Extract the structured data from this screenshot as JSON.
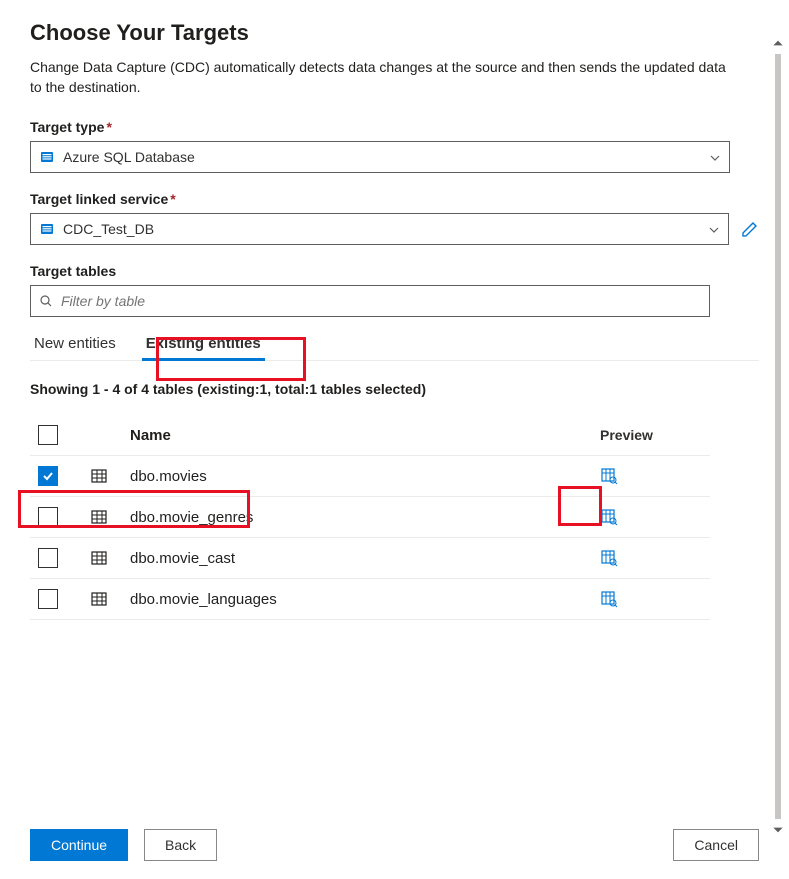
{
  "header": {
    "title": "Choose Your Targets",
    "description": "Change Data Capture (CDC) automatically detects data changes at the source and then sends the updated data to the destination."
  },
  "fields": {
    "target_type": {
      "label": "Target type",
      "value": "Azure SQL Database"
    },
    "target_linked_service": {
      "label": "Target linked service",
      "value": "CDC_Test_DB"
    },
    "target_tables": {
      "label": "Target tables",
      "placeholder": "Filter by table"
    }
  },
  "tabs": {
    "new_entities": "New entities",
    "existing_entities": "Existing entities",
    "active": "existing_entities"
  },
  "summary": "Showing 1 - 4 of 4 tables (existing:1, total:1 tables selected)",
  "table": {
    "headers": {
      "name": "Name",
      "preview": "Preview"
    },
    "rows": [
      {
        "name": "dbo.movies",
        "checked": true
      },
      {
        "name": "dbo.movie_genres",
        "checked": false
      },
      {
        "name": "dbo.movie_cast",
        "checked": false
      },
      {
        "name": "dbo.movie_languages",
        "checked": false
      }
    ]
  },
  "footer": {
    "continue": "Continue",
    "back": "Back",
    "cancel": "Cancel"
  }
}
